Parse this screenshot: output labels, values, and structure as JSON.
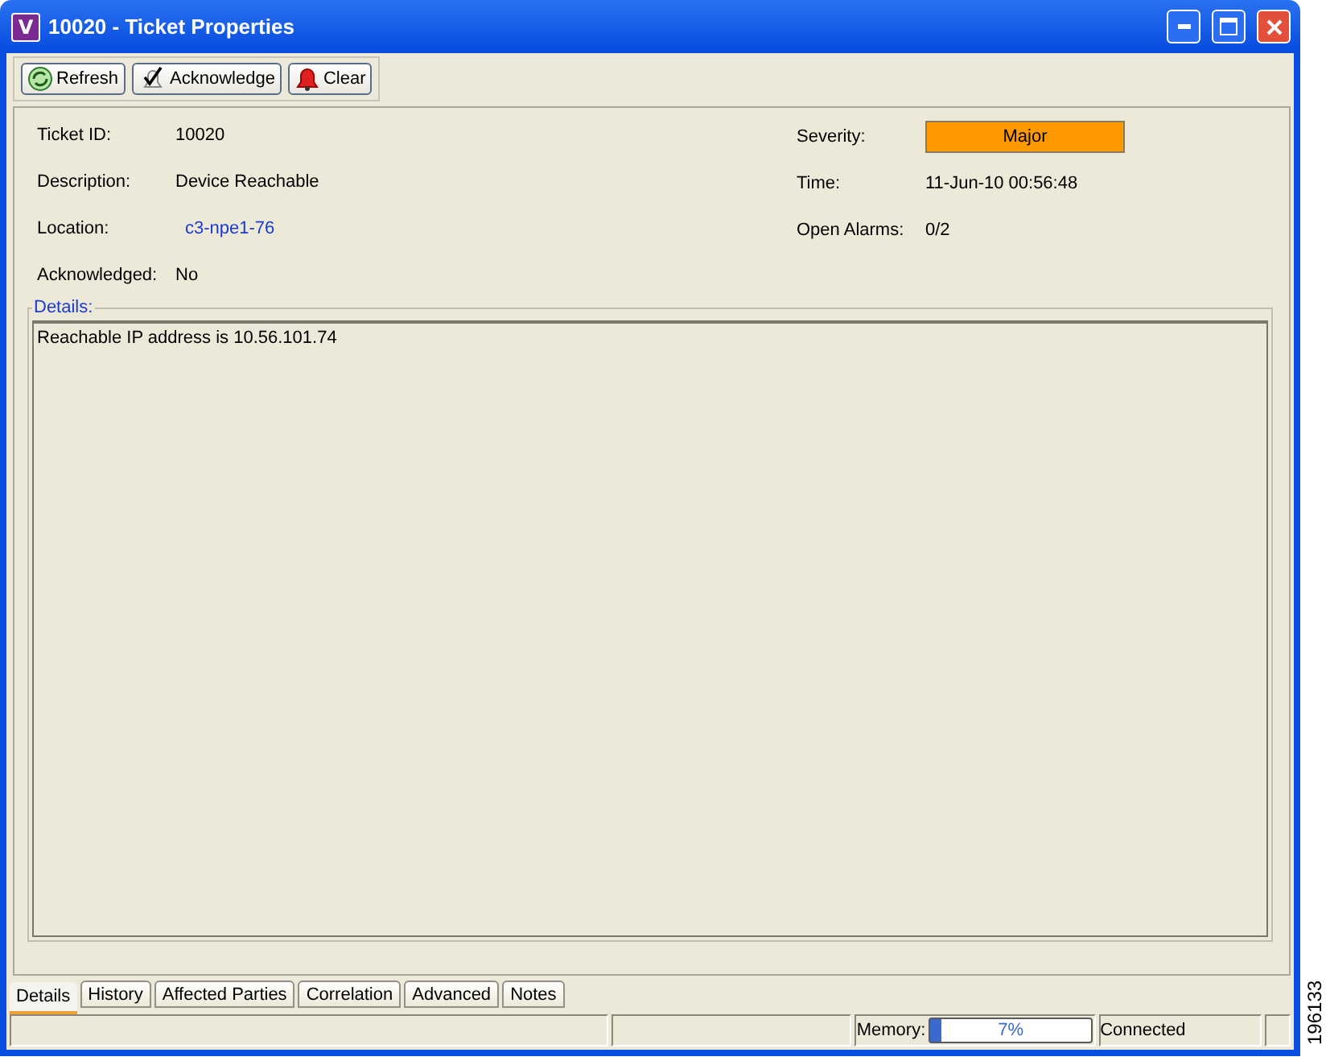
{
  "window": {
    "app_icon": "V",
    "title": "10020 - Ticket Properties"
  },
  "toolbar": [
    {
      "kind": "refresh",
      "label": "Refresh"
    },
    {
      "kind": "acknowledge",
      "label": "Acknowledge"
    },
    {
      "kind": "clear",
      "label": "Clear"
    }
  ],
  "fields_left": [
    {
      "label": "Ticket ID:",
      "value": "10020",
      "kind": "text"
    },
    {
      "label": "Description:",
      "value": "Device Reachable",
      "kind": "text"
    },
    {
      "label": "Location:",
      "value": "c3-npe1-76",
      "kind": "link"
    },
    {
      "label": "Acknowledged:",
      "value": "No",
      "kind": "text"
    }
  ],
  "fields_right": [
    {
      "label": "Severity:",
      "value": "Major",
      "kind": "badge",
      "color": "#ff9900"
    },
    {
      "label": "Time:",
      "value": "11-Jun-10 00:56:48",
      "kind": "text"
    },
    {
      "label": "Open Alarms:",
      "value": "0/2",
      "kind": "text"
    }
  ],
  "details": {
    "legend": "Details:",
    "text": "Reachable IP address is 10.56.101.74"
  },
  "tabs": [
    {
      "label": "Details",
      "selected": true
    },
    {
      "label": "History",
      "selected": false
    },
    {
      "label": "Affected Parties",
      "selected": false
    },
    {
      "label": "Correlation",
      "selected": false
    },
    {
      "label": "Advanced",
      "selected": false
    },
    {
      "label": "Notes",
      "selected": false
    }
  ],
  "status_bar": {
    "memory_label": "Memory:",
    "memory": {
      "level": 0.07,
      "reading": "7%"
    },
    "connection": "Connected"
  },
  "figure_id": "196133"
}
